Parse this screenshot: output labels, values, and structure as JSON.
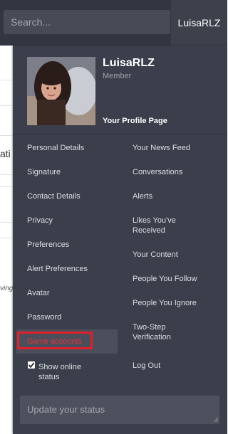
{
  "header": {
    "search_placeholder": "Search...",
    "username": "LuisaRLZ"
  },
  "background": {
    "fragment_1": "ati",
    "fragment_2": "ving"
  },
  "profile": {
    "name": "LuisaRLZ",
    "role": "Member",
    "profile_link": "Your Profile Page"
  },
  "menu_left": [
    "Personal Details",
    "Signature",
    "Contact Details",
    "Privacy",
    "Preferences",
    "Alert Preferences",
    "Avatar",
    "Password",
    "Game accounts"
  ],
  "menu_right": [
    "Your News Feed",
    "Conversations",
    "Alerts",
    "Likes You've Received",
    "Your Content",
    "People You Follow",
    "People You Ignore",
    "Two-Step Verification",
    "Log Out"
  ],
  "online_status": {
    "label": "Show online status",
    "checked": true
  },
  "status_input": {
    "placeholder": "Update your status"
  },
  "colors": {
    "highlight_border": "#e0202a",
    "panel_bg": "#3a3f4b"
  }
}
